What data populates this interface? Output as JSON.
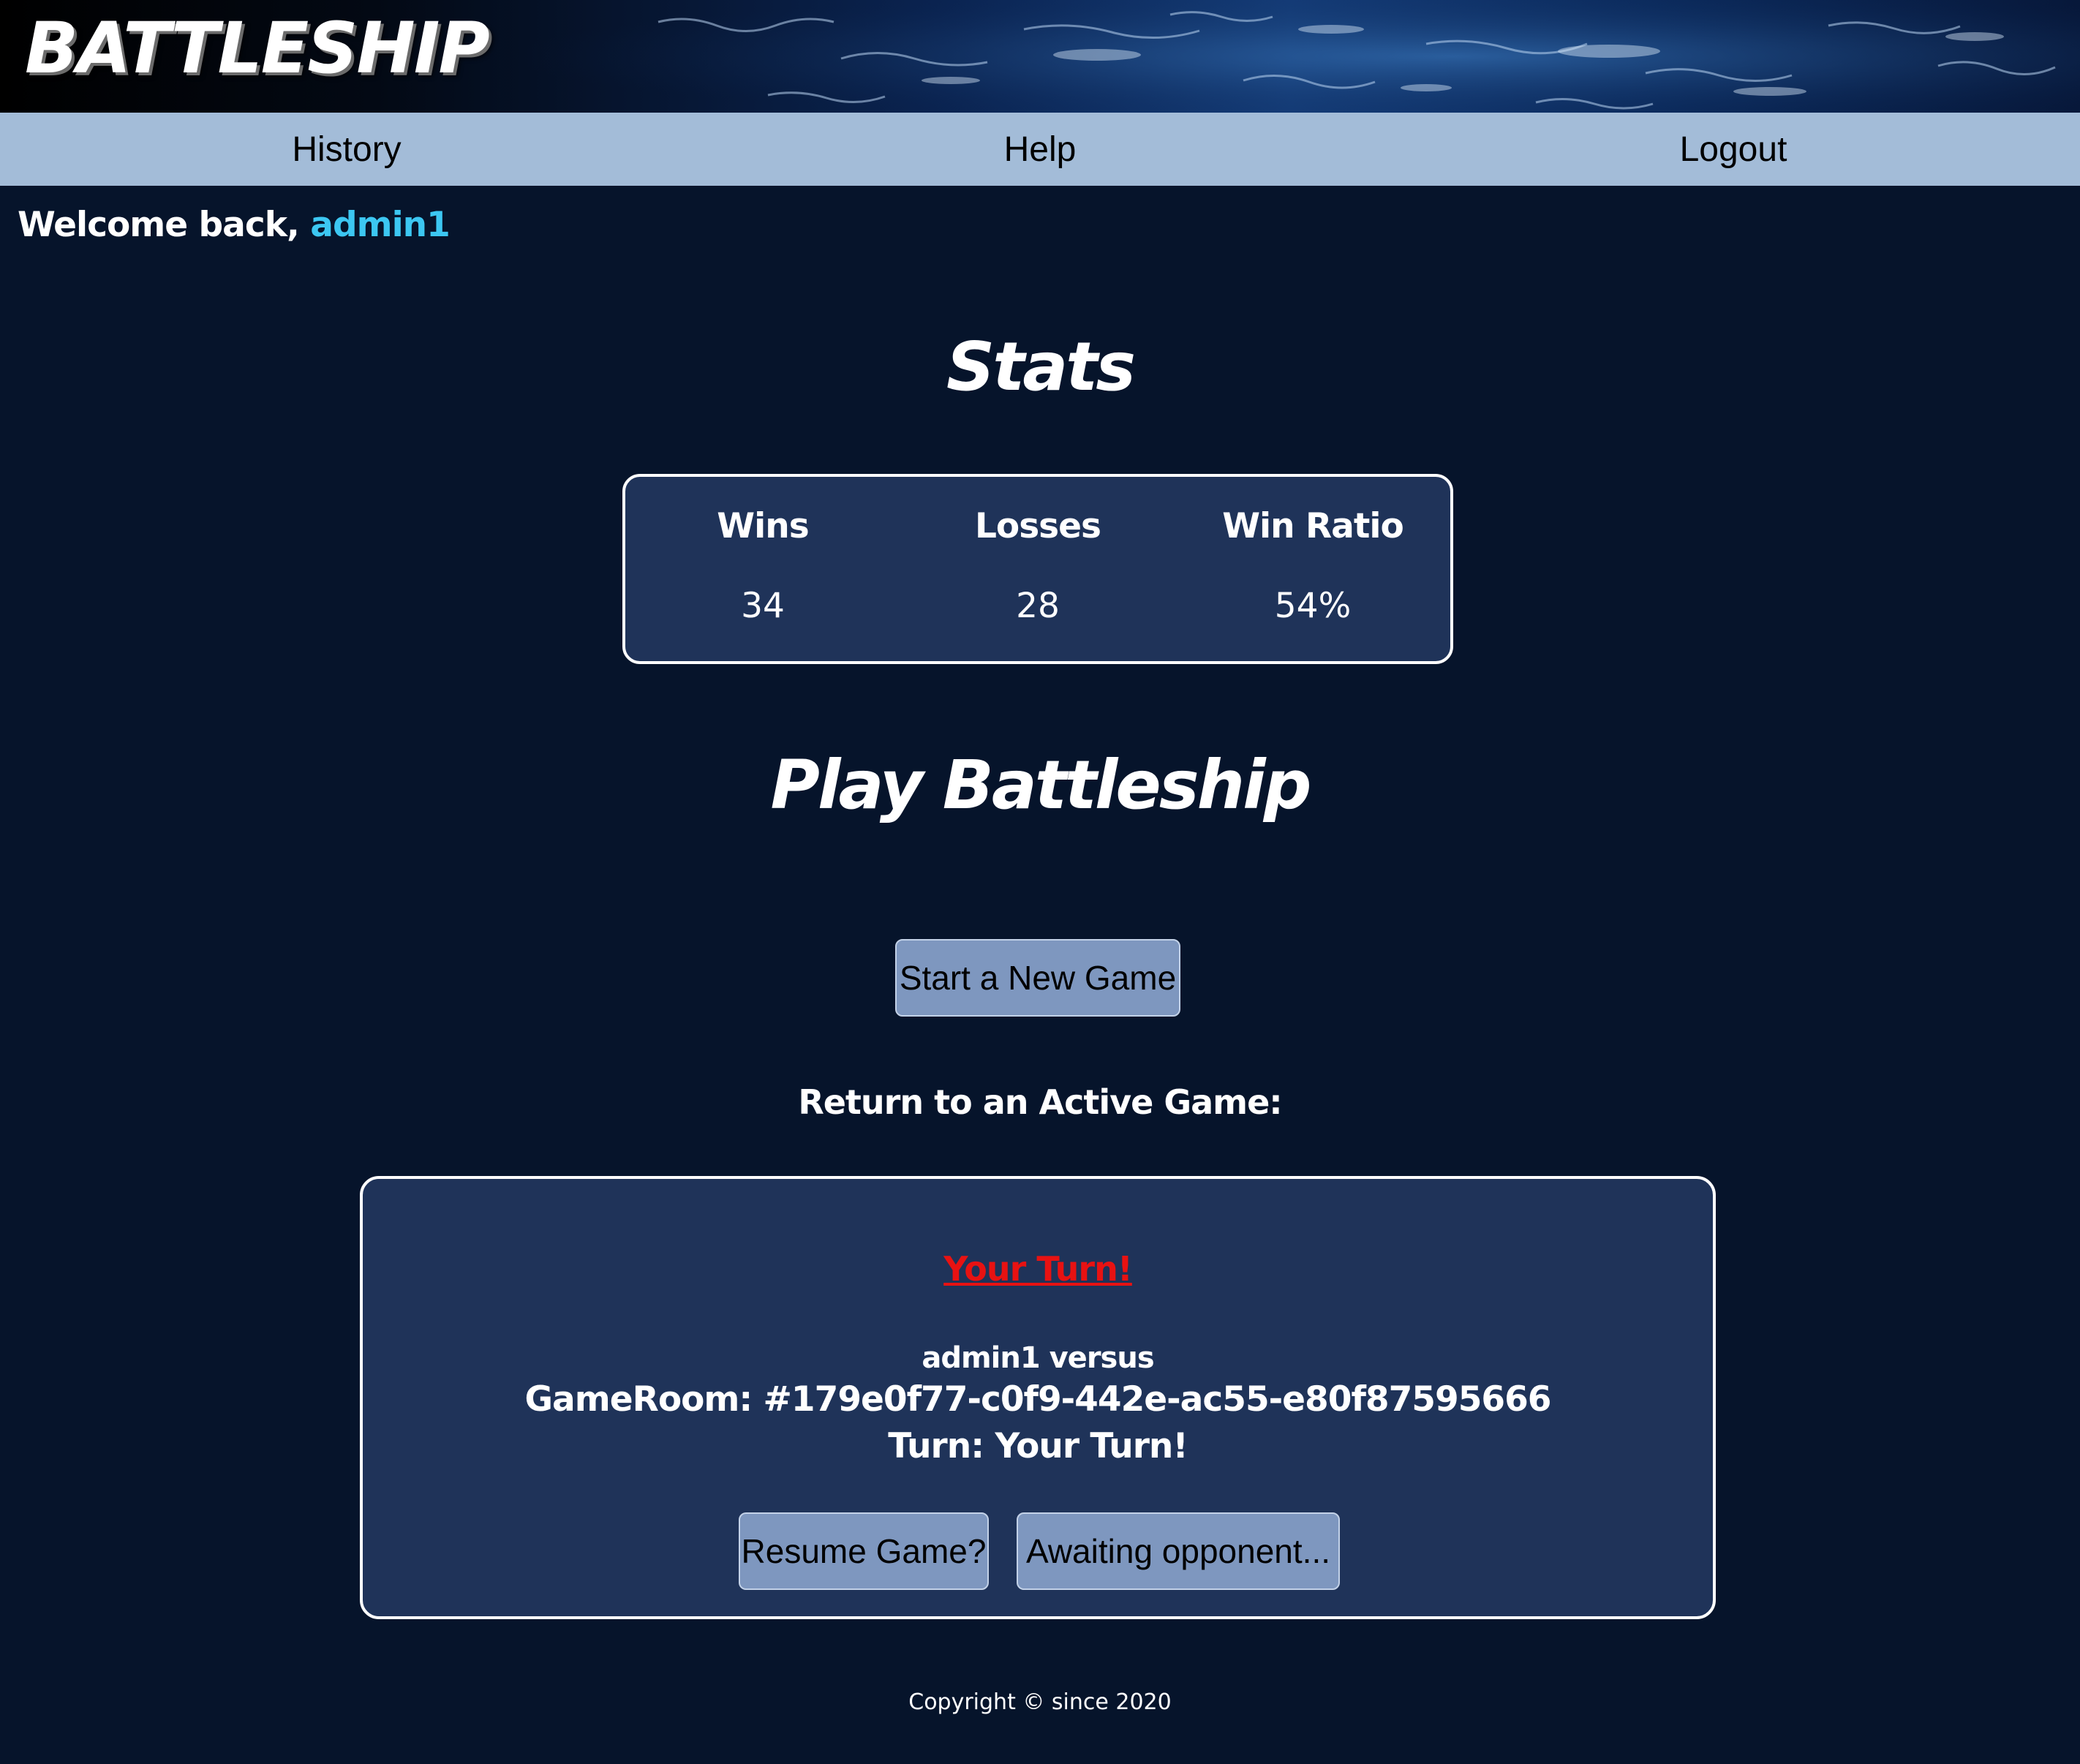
{
  "app": {
    "logo": "BATTLESHIP"
  },
  "nav": {
    "history": "History",
    "help": "Help",
    "logout": "Logout"
  },
  "welcome": {
    "prefix": "Welcome back,",
    "username": "admin1"
  },
  "stats": {
    "title": "Stats",
    "wins_label": "Wins",
    "wins_value": "34",
    "losses_label": "Losses",
    "losses_value": "28",
    "ratio_label": "Win Ratio",
    "ratio_value": "54%"
  },
  "play": {
    "title": "Play Battleship",
    "new_game_button": "Start a New Game",
    "return_label": "Return to an Active Game:"
  },
  "active_game": {
    "turn_link": "Your Turn!",
    "versus": "admin1 versus",
    "room": "GameRoom: #179e0f77-c0f9-442e-ac55-e80f87595666",
    "turn": "Turn: Your Turn!",
    "resume_button": "Resume Game?",
    "awaiting_button": "Awaiting opponent..."
  },
  "footer": {
    "copyright": "Copyright © since 2020"
  },
  "colors": {
    "background": "#06142b",
    "nav_bar": "#a3bcd8",
    "card": "#1f3359",
    "username": "#3cc7f2",
    "turn_link": "#e81212",
    "button": "#7e97bf"
  }
}
